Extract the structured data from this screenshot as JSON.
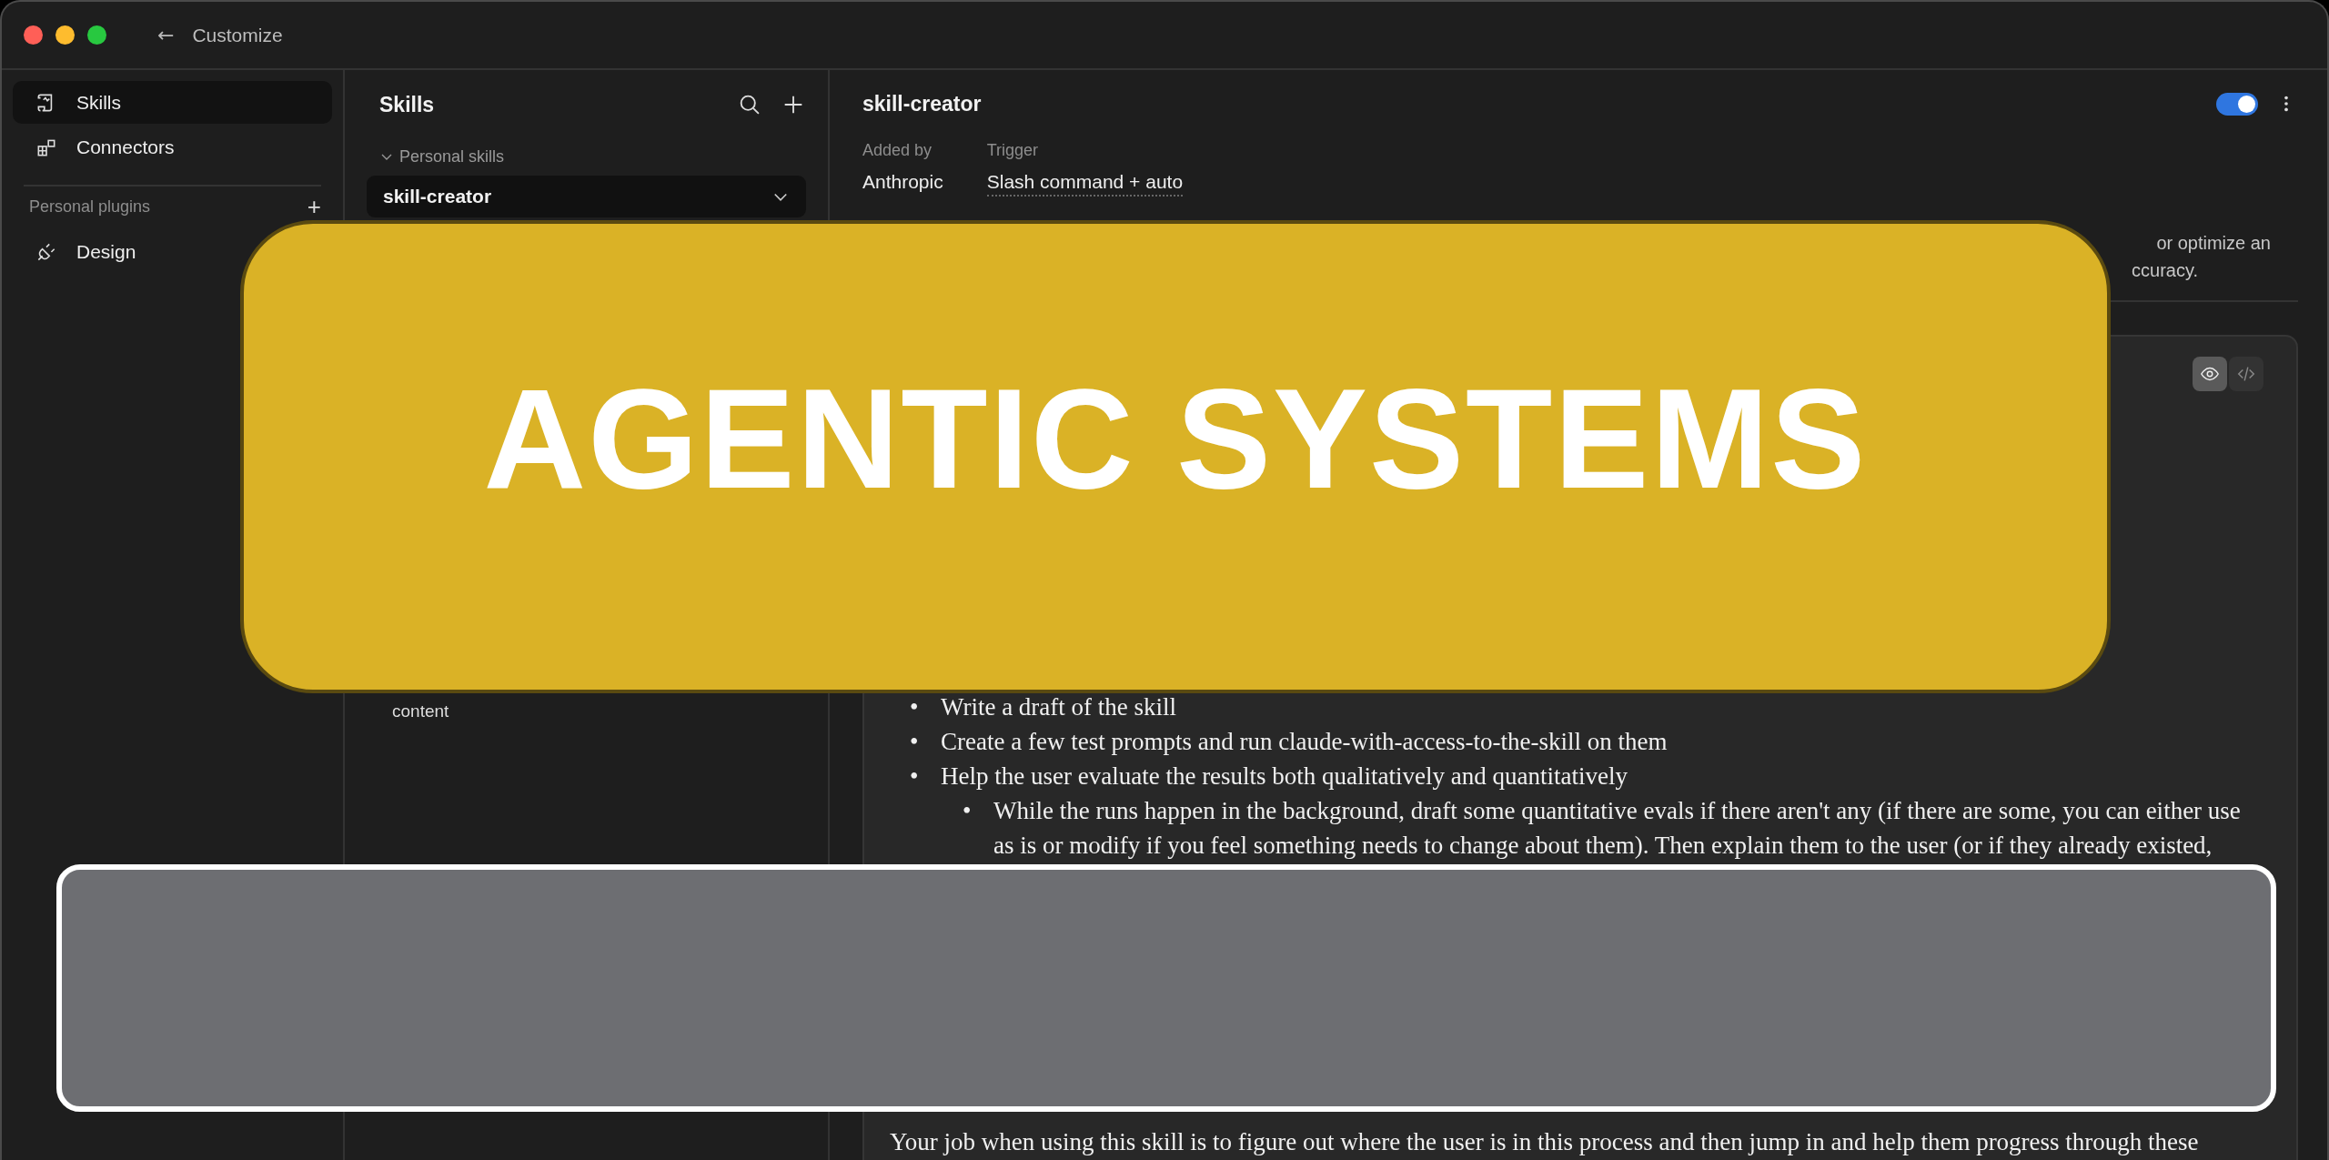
{
  "window": {
    "title": "Customize",
    "back_icon": "←"
  },
  "sidebar": {
    "items": [
      {
        "label": "Skills",
        "selected": true
      },
      {
        "label": "Connectors",
        "selected": false
      }
    ],
    "section": {
      "title": "Personal plugins",
      "add": "+"
    },
    "plugins": [
      {
        "label": "Design",
        "selected": false
      }
    ]
  },
  "skills_panel": {
    "title": "Skills",
    "group": {
      "label": "Personal skills",
      "expanded": true
    },
    "items": [
      {
        "label": "skill-creator",
        "selected": true,
        "expanded": true
      }
    ],
    "files": [
      {
        "label": "content"
      }
    ]
  },
  "detail": {
    "title": "skill-creator",
    "enabled": true,
    "meta": [
      {
        "label": "Added by",
        "value": "Anthropic",
        "kind": "plain"
      },
      {
        "label": "Trigger",
        "value": "Slash command + auto",
        "kind": "dotted"
      }
    ],
    "description": [
      "or optimize an",
      "ccuracy."
    ],
    "view_modes": [
      {
        "kind": "preview",
        "selected": true
      },
      {
        "kind": "code",
        "selected": false
      }
    ],
    "bullets": [
      {
        "marker": "•",
        "text": "Write a draft of the skill"
      },
      {
        "marker": "•",
        "text": "Create a few test prompts and run claude-with-access-to-the-skill on them"
      },
      {
        "marker": "•",
        "text": "Help the user evaluate the results both qualitatively and quantitatively",
        "children": [
          {
            "marker": "•",
            "text": "While the runs happen in the background, draft some quantitative evals if there aren't any (if there are some, you can either use as is or modify if you feel something needs to change about them). Then explain them to the user (or if they already existed,"
          }
        ]
      }
    ],
    "paragraph": "Your job when using this skill is to figure out where the user is in this process and then jump in and help them progress through these"
  },
  "overlays": {
    "banner": "AGENTIC SYSTEMS"
  }
}
